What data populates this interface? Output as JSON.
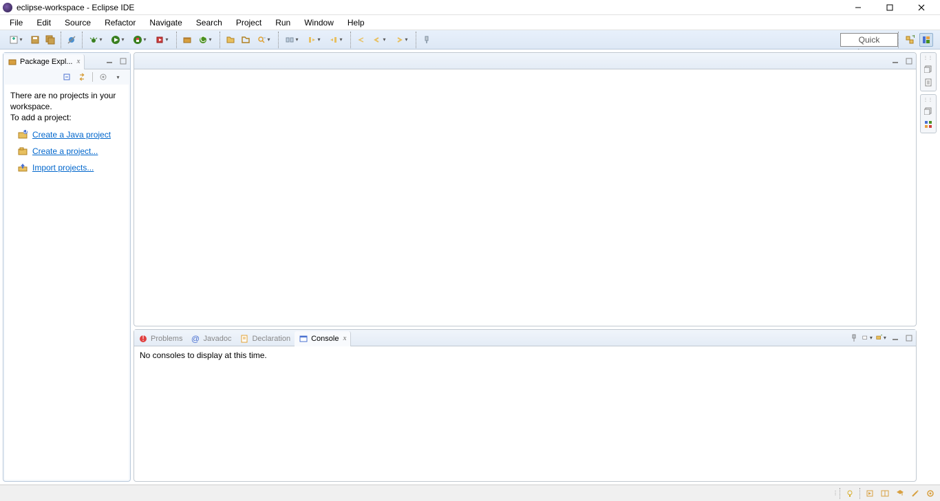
{
  "window": {
    "title": "eclipse-workspace - Eclipse IDE"
  },
  "menu": {
    "items": [
      "File",
      "Edit",
      "Source",
      "Refactor",
      "Navigate",
      "Search",
      "Project",
      "Run",
      "Window",
      "Help"
    ]
  },
  "toolbar": {
    "quick_access": "Quick Access"
  },
  "package_explorer": {
    "tab_label": "Package Expl...",
    "msg1": "There are no projects in your workspace.",
    "msg2": "To add a project:",
    "action_java": "Create a Java project",
    "action_project": "Create a project...",
    "action_import": "Import projects..."
  },
  "bottom_tabs": {
    "problems": "Problems",
    "javadoc": "Javadoc",
    "declaration": "Declaration",
    "console": "Console"
  },
  "console": {
    "empty_msg": "No consoles to display at this time."
  }
}
